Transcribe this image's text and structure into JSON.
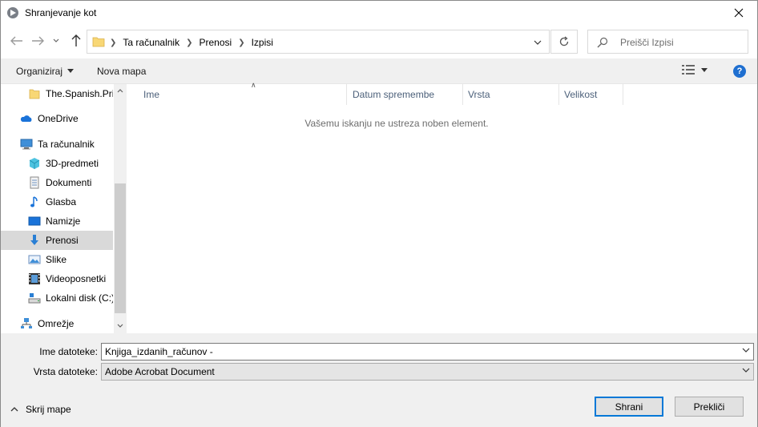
{
  "window": {
    "title": "Shranjevanje kot"
  },
  "address": {
    "crumbs": [
      "Ta računalnik",
      "Prenosi",
      "Izpisi"
    ]
  },
  "search": {
    "placeholder": "Preišči Izpisi"
  },
  "commands": {
    "organize": "Organiziraj",
    "new_folder": "Nova mapa"
  },
  "sidebar": {
    "items": [
      {
        "label": "The.Spanish.Prin",
        "icon": "folder-icon"
      },
      {
        "label": "OneDrive",
        "icon": "onedrive-cloud-icon"
      },
      {
        "label": "Ta računalnik",
        "icon": "computer-icon"
      },
      {
        "label": "3D-predmeti",
        "icon": "3d-objects-icon"
      },
      {
        "label": "Dokumenti",
        "icon": "documents-icon"
      },
      {
        "label": "Glasba",
        "icon": "music-icon"
      },
      {
        "label": "Namizje",
        "icon": "desktop-icon"
      },
      {
        "label": "Prenosi",
        "icon": "downloads-icon",
        "selected": true
      },
      {
        "label": "Slike",
        "icon": "pictures-icon"
      },
      {
        "label": "Videoposnetki",
        "icon": "videos-icon"
      },
      {
        "label": "Lokalni disk (C:)",
        "icon": "local-disk-icon"
      },
      {
        "label": "Omrežje",
        "icon": "network-icon"
      }
    ]
  },
  "filelist": {
    "columns": [
      "Ime",
      "Datum spremembe",
      "Vrsta",
      "Velikost"
    ],
    "empty_message": "Vašemu iskanju ne ustreza noben element."
  },
  "form": {
    "filename_label": "Ime datoteke:",
    "filename_value": "Knjiga_izdanih_računov -",
    "filetype_label": "Vrsta datoteke:",
    "filetype_value": "Adobe Acrobat Document"
  },
  "footer": {
    "hide_folders": "Skrij mape",
    "save": "Shrani",
    "cancel": "Prekliči"
  },
  "colors": {
    "accent": "#0078d7",
    "selected_bg": "#d9d9d9",
    "panel_bg": "#f0f0f0"
  }
}
